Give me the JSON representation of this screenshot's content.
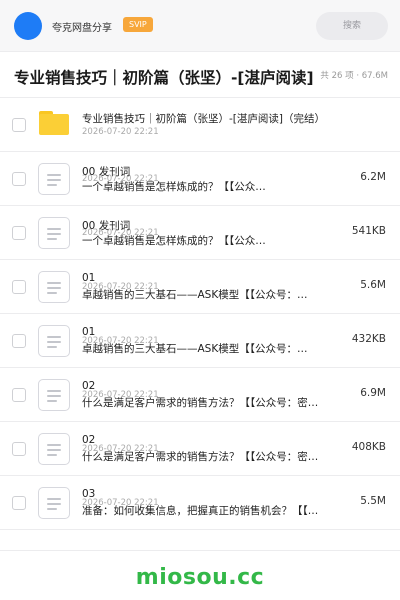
{
  "header": {
    "brand": "夸克网盘分享",
    "badge": "SVIP",
    "search_label": "搜索"
  },
  "share": {
    "title": "专业销售技巧｜初阶篇（张坚）-[湛庐阅读]",
    "meta": "共 26 项 · 67.6M"
  },
  "folder": {
    "name": "专业销售技巧｜初阶篇（张坚）-[湛庐阅读]（完结）",
    "date": "2026-07-20 22:21"
  },
  "files": [
    {
      "prefix": "00 发刊词",
      "title": "一个卓越销售是怎样炼成的？【【公众…",
      "date": "2026-07-20 22:21",
      "size": "6.2M"
    },
    {
      "prefix": "00 发刊词",
      "title": "一个卓越销售是怎样炼成的？【【公众…",
      "date": "2026-07-20 22:21",
      "size": "541KB"
    },
    {
      "prefix": "01",
      "title": "卓越销售的三大基石——ASK模型【【公众号：…",
      "date": "2026-07-20 22:21",
      "size": "5.6M"
    },
    {
      "prefix": "01",
      "title": "卓越销售的三大基石——ASK模型【【公众号：…",
      "date": "2026-07-20 22:21",
      "size": "432KB"
    },
    {
      "prefix": "02",
      "title": "什么是满足客户需求的销售方法？【【公众号：密…",
      "date": "2026-07-20 22:21",
      "size": "6.9M"
    },
    {
      "prefix": "02",
      "title": "什么是满足客户需求的销售方法？【【公众号：密…",
      "date": "2026-07-20 22:21",
      "size": "408KB"
    },
    {
      "prefix": "03",
      "title": "准备：如何收集信息，把握真正的销售机会？【【…",
      "date": "2026-07-20 22:21",
      "size": "5.5M"
    }
  ],
  "footer": {
    "watermark": "miosou.cc"
  },
  "colors": {
    "accent": "#1e7cf6",
    "svip": "#f7a73b",
    "folder": "#fbcf36",
    "watermark": "#33b848"
  }
}
